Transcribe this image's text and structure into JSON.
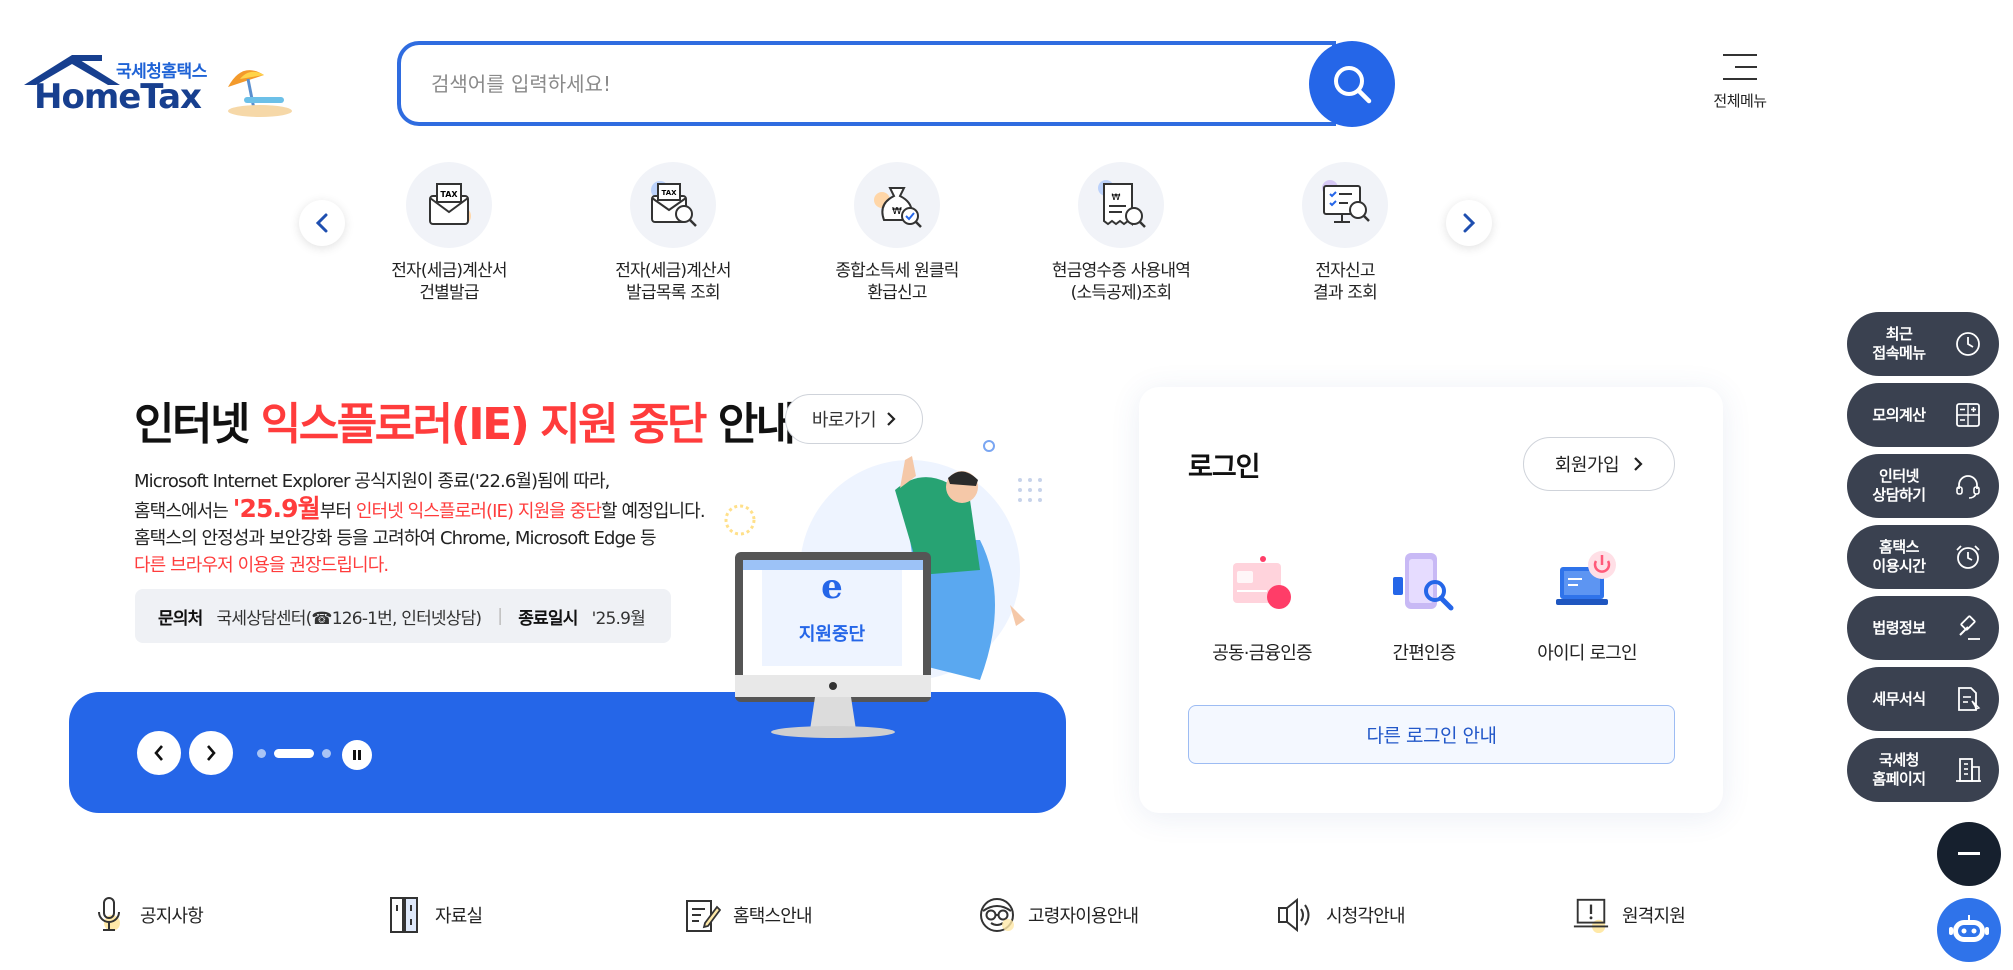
{
  "header": {
    "logo_sub": "국세청홈택스",
    "logo_main": "HomeTax",
    "search_placeholder": "검색어를 입력하세요!",
    "search_icon": "search-icon",
    "menu_all_label": "전체메뉴"
  },
  "quick_services": [
    {
      "label": "전자(세금)계산서\n건별발급",
      "icon": "tax-invoice-envelope-icon"
    },
    {
      "label": "전자(세금)계산서\n발급목록 조회",
      "icon": "tax-invoice-search-icon"
    },
    {
      "label": "종합소득세 원클릭\n환급신고",
      "icon": "money-bag-search-icon"
    },
    {
      "label": "현금영수증 사용내역\n(소득공제)조회",
      "icon": "receipt-search-icon"
    },
    {
      "label": "전자신고\n결과 조회",
      "icon": "monitor-search-icon"
    }
  ],
  "banner": {
    "title_pre": "인터넷 ",
    "title_red": "익스플로러(IE) 지원 중단",
    "title_post": " 안내",
    "go_label": "바로가기",
    "line1": "Microsoft Internet Explorer 공식지원이 종료('22.6월)됨에 따라,",
    "line2_pre": "홈택스에서는 ",
    "line2_big": "'25.9월",
    "line2_mid": "부터 ",
    "line2_red": "인터넷 익스플로러(IE) 지원을 중단",
    "line2_post": "할 예정입니다.",
    "line3": "홈택스의 안정성과 보안강화 등을 고려하여 Chrome, Microsoft Edge 등",
    "line4_red": "다른 브라우저 이용을 권장드립니다.",
    "info_label1": "문의처",
    "info_value1": "국세상담센터(☎126-1번, 인터넷상담)",
    "info_label2": "종료일시",
    "info_value2": "'25.9월",
    "illust_text": "지원중단",
    "slides_total": 3,
    "slide_active": 2
  },
  "login": {
    "title": "로그인",
    "signup_label": "회원가입",
    "options": [
      {
        "label": "공동·금융인증",
        "icon": "certificate-card-icon"
      },
      {
        "label": "간편인증",
        "icon": "phone-search-icon"
      },
      {
        "label": "아이디 로그인",
        "icon": "laptop-power-icon"
      }
    ],
    "other_login_label": "다른 로그인 안내"
  },
  "side_menu": [
    {
      "label": "최근\n접속메뉴",
      "icon": "clock-icon"
    },
    {
      "label": "모의계산",
      "icon": "calculator-icon"
    },
    {
      "label": "인터넷\n상담하기",
      "icon": "headset-icon"
    },
    {
      "label": "홈택스\n이용시간",
      "icon": "alarm-clock-icon"
    },
    {
      "label": "법령정보",
      "icon": "gavel-icon"
    },
    {
      "label": "세무서식",
      "icon": "document-edit-icon"
    },
    {
      "label": "국세청\n홈페이지",
      "icon": "building-icon"
    }
  ],
  "bottom_links": [
    {
      "label": "공지사항",
      "icon": "microphone-icon"
    },
    {
      "label": "자료실",
      "icon": "file-cabinet-icon"
    },
    {
      "label": "홈택스안내",
      "icon": "note-pencil-icon"
    },
    {
      "label": "고령자이용안내",
      "icon": "glasses-face-icon"
    },
    {
      "label": "시청각안내",
      "icon": "speaker-icon"
    },
    {
      "label": "원격지원",
      "icon": "laptop-alert-icon"
    }
  ],
  "colors": {
    "primary_blue": "#2566e8",
    "dark_blue": "#173f8f",
    "accent_red": "#ff3c3c",
    "side_btn_bg": "#3a4150"
  }
}
